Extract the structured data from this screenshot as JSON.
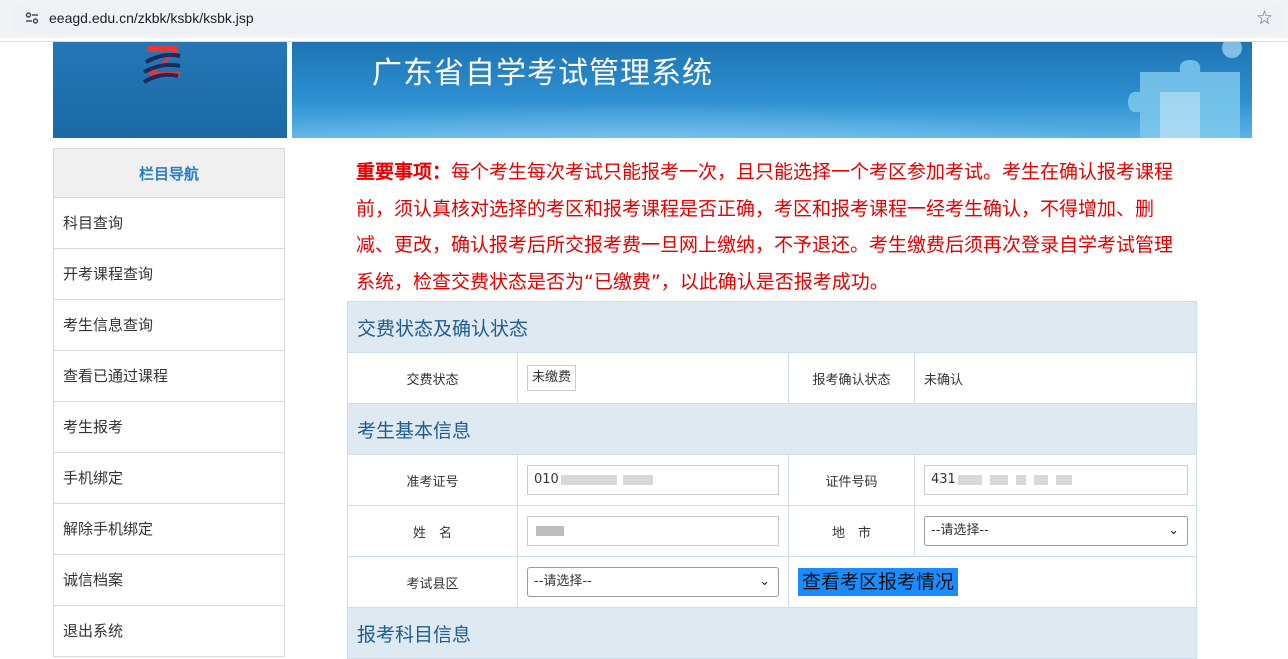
{
  "browser": {
    "url": "eeagd.edu.cn/zkbk/ksbk/ksbk.jsp",
    "site_info_icon": "tune-icon",
    "bookmark_icon": "star-icon"
  },
  "banner": {
    "title": "广东省自学考试管理系统",
    "logo_icon": "emblem-logo",
    "decor_icon": "puzzle-icon"
  },
  "sidebar": {
    "heading": "栏目导航",
    "items": [
      {
        "label": "科目查询"
      },
      {
        "label": "开考课程查询"
      },
      {
        "label": "考生信息查询"
      },
      {
        "label": "查看已通过课程"
      },
      {
        "label": "考生报考"
      },
      {
        "label": "手机绑定"
      },
      {
        "label": "解除手机绑定"
      },
      {
        "label": "诚信档案"
      },
      {
        "label": "退出系统"
      }
    ]
  },
  "notice": {
    "label": "重要事项：",
    "text": "每个考生每次考试只能报考一次，且只能选择一个考区参加考试。考生在确认报考课程前，须认真核对选择的考区和报考课程是否正确，考区和报考课程一经考生确认，不得增加、删减、更改，确认报考后所交报考费一旦网上缴纳，不予退还。考生缴费后须再次登录自学考试管理系统，检查交费状态是否为“已缴费”，以此确认是否报考成功。"
  },
  "form": {
    "section_status": "交费状态及确认状态",
    "pay_status_label": "交费状态",
    "pay_status_value": "未缴费",
    "confirm_status_label": "报考确认状态",
    "confirm_status_value": "未确认",
    "section_basic": "考生基本信息",
    "exam_no_label": "准考证号",
    "exam_no_value": "010",
    "id_no_label": "证件号码",
    "id_no_value": "431",
    "name_label": "姓　名",
    "city_label": "地　市",
    "city_select": "--请选择--",
    "county_label": "考试县区",
    "county_select": "--请选择--",
    "view_button": "查看考区报考情况",
    "section_subjects": "报考科目信息",
    "colors": {
      "accent": "#1a8cff",
      "warning": "#e60000",
      "section_bg": "#dfe9f2"
    }
  }
}
